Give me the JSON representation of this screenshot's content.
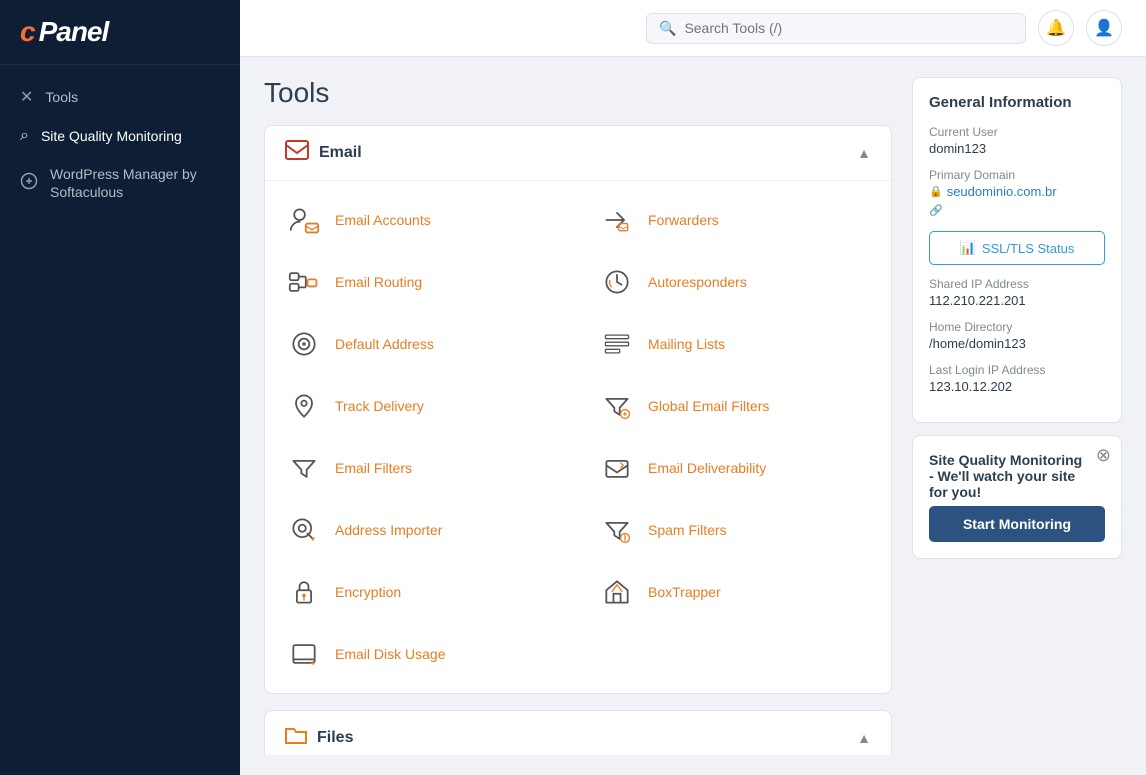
{
  "app": {
    "name": "cPanel"
  },
  "sidebar": {
    "items": [
      {
        "id": "tools",
        "label": "Tools",
        "icon": "✕"
      },
      {
        "id": "site-quality",
        "label": "Site Quality Monitoring",
        "icon": "⌕"
      },
      {
        "id": "wordpress",
        "label": "WordPress Manager by Softaculous",
        "icon": "W"
      }
    ]
  },
  "header": {
    "search_placeholder": "Search Tools (/)"
  },
  "page": {
    "title": "Tools"
  },
  "sections": [
    {
      "id": "email",
      "title": "Email",
      "icon": "✉",
      "tools": [
        {
          "id": "email-accounts",
          "label": "Email Accounts",
          "icon": "person-mail"
        },
        {
          "id": "forwarders",
          "label": "Forwarders",
          "icon": "forward-mail"
        },
        {
          "id": "email-routing",
          "label": "Email Routing",
          "icon": "routing"
        },
        {
          "id": "autoresponders",
          "label": "Autoresponders",
          "icon": "autoresponders"
        },
        {
          "id": "default-address",
          "label": "Default Address",
          "icon": "at-circle"
        },
        {
          "id": "mailing-lists",
          "label": "Mailing Lists",
          "icon": "mailing-lists"
        },
        {
          "id": "track-delivery",
          "label": "Track Delivery",
          "icon": "track"
        },
        {
          "id": "global-email-filters",
          "label": "Global Email Filters",
          "icon": "global-filter"
        },
        {
          "id": "email-filters",
          "label": "Email Filters",
          "icon": "filter"
        },
        {
          "id": "email-deliverability",
          "label": "Email Deliverability",
          "icon": "deliverability"
        },
        {
          "id": "address-importer",
          "label": "Address Importer",
          "icon": "address-importer"
        },
        {
          "id": "spam-filters",
          "label": "Spam Filters",
          "icon": "spam"
        },
        {
          "id": "encryption",
          "label": "Encryption",
          "icon": "lock"
        },
        {
          "id": "boxtrapper",
          "label": "BoxTrapper",
          "icon": "diamond"
        },
        {
          "id": "email-disk-usage",
          "label": "Email Disk Usage",
          "icon": "disk"
        }
      ]
    },
    {
      "id": "files",
      "title": "Files",
      "icon": "📁"
    }
  ],
  "general_info": {
    "title": "General Information",
    "current_user_label": "Current User",
    "current_user": "domin123",
    "primary_domain_label": "Primary Domain",
    "primary_domain": "seudominio.com.br",
    "ssl_btn_label": "SSL/TLS Status",
    "shared_ip_label": "Shared IP Address",
    "shared_ip": "112.210.221.201",
    "home_dir_label": "Home Directory",
    "home_dir": "/home/domin123",
    "last_login_label": "Last Login IP Address",
    "last_login": "123.10.12.202"
  },
  "popup": {
    "title": "Site Quality Monitoring",
    "desc": "- We'll watch your site for you!",
    "btn_label": "Start Monitoring"
  }
}
